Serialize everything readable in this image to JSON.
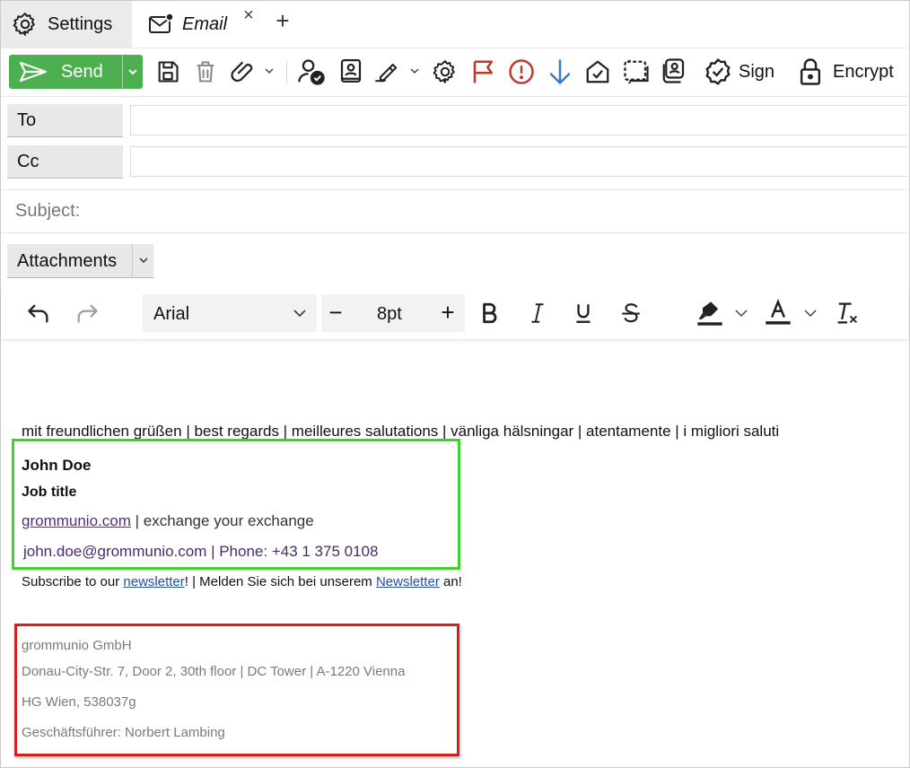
{
  "tabs": [
    {
      "label": "Settings",
      "icon": "gear-icon"
    },
    {
      "label": "Email",
      "icon": "mail-notification-icon"
    }
  ],
  "tab_close_glyph": "×",
  "tab_add_glyph": "+",
  "toolbar": {
    "send_label": "Send",
    "sign_label": "Sign",
    "encrypt_label": "Encrypt",
    "accent_color": "#4caf50",
    "flag_color": "#c0392b",
    "importance_color": "#c0392b",
    "low_priority_color": "#3a7fc1"
  },
  "recipients": {
    "to_label": "To",
    "to_value": "",
    "cc_label": "Cc",
    "cc_value": ""
  },
  "subject": {
    "placeholder": "Subject:",
    "value": ""
  },
  "attachments": {
    "label": "Attachments"
  },
  "format": {
    "font": "Arial",
    "size": "8pt",
    "minus": "−",
    "plus": "+"
  },
  "body": {
    "greeting": "mit freundlichen grüßen | best regards | meilleures salutations | vänliga hälsningar | atentamente | i migliori saluti",
    "signature": {
      "name": "John Doe",
      "job_title": "Job title",
      "website": "grommunio.com",
      "tagline": " | exchange your exchange",
      "contact": "john.doe@grommunio.com | Phone: +43 1 375 0108",
      "box_color": "#3ed32a"
    },
    "subscribe": {
      "text1": "Subscribe to our ",
      "link1": "newsletter",
      "text2": "! | Melden Sie sich bei unserem ",
      "link2": "Newsletter",
      "text3": " an!"
    },
    "footer": {
      "company": "grommunio GmbH",
      "address": "Donau-City-Str. 7, Door 2, 30th floor | DC Tower | A-1220 Vienna",
      "registry": "HG Wien, 538037g",
      "director": "Geschäftsführer: Norbert Lambing",
      "box_color": "#d62020"
    }
  }
}
